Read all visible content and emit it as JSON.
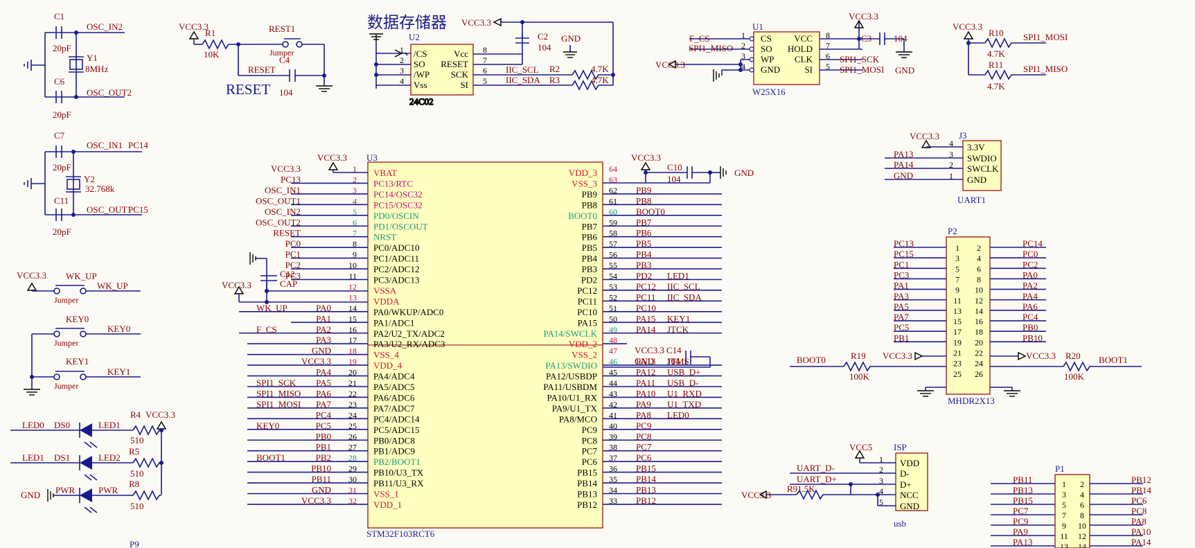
{
  "colors": {
    "wire": "#1a1a8c",
    "net": "#8b0000",
    "body": "#ffffc0",
    "bodyStroke": "#8b0000",
    "pinRed": "#d0103a",
    "pinGreen": "#1a9a7a",
    "pinBlack": "#000000"
  },
  "title_cn": "数据存储器",
  "reset_text": "RESET",
  "osc": {
    "c1": "C1",
    "c6": "C6",
    "c1v": "20pF",
    "c6v": "20pF",
    "y1": "Y1",
    "y1v": "8MHz",
    "osc_in2": "OSC_IN2",
    "osc_out2": "OSC_OUT2",
    "c7": "C7",
    "c11": "C11",
    "c7v": "20pF",
    "c11v": "20pF",
    "y2": "Y2",
    "y2v": "32.768k",
    "osc_in1": "OSC_IN1",
    "pc14": "PC14",
    "osc_out1": "OSC_OUT1",
    "pc15": "PC15"
  },
  "reset_ckt": {
    "vcc": "VCC3.3",
    "r1": "R1",
    "r1v": "10K",
    "rest1": "REST1",
    "jumper": "Jumper",
    "c4": "C4",
    "reset_net": "RESET",
    "c4v": "104"
  },
  "u2": {
    "ref": "U2",
    "part": "24C02",
    "vcc": "VCC3.3",
    "c2": "C2",
    "c2v": "104",
    "gnd": "GND",
    "r2": "R2",
    "r3": "R3",
    "r2v": "4.7K",
    "r3v": "4.7K",
    "iic_scl": "IIC_SCL",
    "iic_sda": "IIC_SDA",
    "left": [
      {
        "n": "1",
        "t": "/CS"
      },
      {
        "n": "2",
        "t": "SO"
      },
      {
        "n": "3",
        "t": "/WP"
      },
      {
        "n": "4",
        "t": "Vss"
      }
    ],
    "right": [
      {
        "n": "8",
        "t": "Vcc"
      },
      {
        "n": "7",
        "t": "RESET"
      },
      {
        "n": "6",
        "t": "SCK"
      },
      {
        "n": "5",
        "t": "SI"
      }
    ]
  },
  "u1": {
    "ref": "U1",
    "part": "W25X16",
    "f_cs": "F_CS",
    "spi1_miso": "SPI1_MISO",
    "vcc": "VCC3.3",
    "c3": "C3",
    "c3v": "104",
    "gnd": "GND",
    "spi1_sck": "SPI1_SCK",
    "spi1_mosi": "SPI1_MOSI",
    "left": [
      {
        "n": "1",
        "t": "CS"
      },
      {
        "n": "2",
        "t": "SO"
      },
      {
        "n": "3",
        "t": "WP"
      },
      {
        "n": "4",
        "t": "GND"
      }
    ],
    "right": [
      {
        "n": "8",
        "t": "VCC"
      },
      {
        "n": "7",
        "t": "HOLD"
      },
      {
        "n": "6",
        "t": "CLK"
      },
      {
        "n": "5",
        "t": "SI"
      }
    ]
  },
  "pullups": {
    "vcc": "VCC3.3",
    "r10": "R10",
    "r10v": "4.7K",
    "n10": "SPI1_MOSI",
    "r11": "R11",
    "r11v": "4.7K",
    "n11": "SPI1_MISO"
  },
  "j3": {
    "ref": "J3",
    "part": "UART1",
    "vcc": "VCC3.3",
    "rows": [
      {
        "n": "4",
        "t": "3.3V",
        "net": ""
      },
      {
        "n": "3",
        "t": "SWDIO",
        "net": "PA13"
      },
      {
        "n": "2",
        "t": "SWCLK",
        "net": "PA14"
      },
      {
        "n": "1",
        "t": "GND",
        "net": "GND"
      }
    ]
  },
  "u3": {
    "ref": "U3",
    "part": "STM32F103RCT6",
    "left": [
      {
        "n": "1",
        "t": "VBAT",
        "c": "r",
        "net": "VCC3.3"
      },
      {
        "n": "2",
        "t": "PC13/RTC",
        "c": "m",
        "net": "PC13"
      },
      {
        "n": "3",
        "t": "PC14/OSC32",
        "c": "m",
        "net": "OSC_IN1"
      },
      {
        "n": "4",
        "t": "PC15/OSC32",
        "c": "m",
        "net": "OSC_OUT1"
      },
      {
        "n": "5",
        "t": "PD0/OSCIN",
        "c": "g",
        "net": "OSC_IN2"
      },
      {
        "n": "6",
        "t": "PD1/OSCOUT",
        "c": "g",
        "net": "OSC_OUT2"
      },
      {
        "n": "7",
        "t": "NRST",
        "c": "g",
        "net": "RESET"
      },
      {
        "n": "8",
        "t": "PC0/ADC10",
        "c": "k",
        "net": "PC0"
      },
      {
        "n": "9",
        "t": "PC1/ADC11",
        "c": "k",
        "net": "PC1"
      },
      {
        "n": "10",
        "t": "PC2/ADC12",
        "c": "k",
        "net": "PC2"
      },
      {
        "n": "11",
        "t": "PC3/ADC13",
        "c": "k",
        "net": "PC3"
      },
      {
        "n": "12",
        "t": "VSSA",
        "c": "r",
        "net": ""
      },
      {
        "n": "13",
        "t": "VDDA",
        "c": "r",
        "net": ""
      },
      {
        "n": "14",
        "t": "PA0/WKUP/ADC0",
        "c": "k",
        "net": "PA0",
        "ext": "WK_UP"
      },
      {
        "n": "15",
        "t": "PA1/ADC1",
        "c": "k",
        "net": "PA1"
      },
      {
        "n": "16",
        "t": "PA2/U2_TX/ADC2",
        "c": "k",
        "net": "PA2",
        "ext": "F_CS"
      },
      {
        "n": "17",
        "t": "PA3/U2_RX/ADC3",
        "c": "k",
        "net": "PA3"
      },
      {
        "n": "18",
        "t": "VSS_4",
        "c": "r",
        "net": "GND"
      },
      {
        "n": "19",
        "t": "VDD_4",
        "c": "r",
        "net": "VCC3.3"
      },
      {
        "n": "20",
        "t": "PA4/ADC4",
        "c": "k",
        "net": "PA4"
      },
      {
        "n": "21",
        "t": "PA5/ADC5",
        "c": "k",
        "net": "PA5",
        "ext": "SPI1_SCK"
      },
      {
        "n": "22",
        "t": "PA6/ADC6",
        "c": "k",
        "net": "PA6",
        "ext": "SPI1_MISO"
      },
      {
        "n": "23",
        "t": "PA7/ADC7",
        "c": "k",
        "net": "PA7",
        "ext": "SPI1_MOSI"
      },
      {
        "n": "24",
        "t": "PC4/ADC14",
        "c": "k",
        "net": "PC4"
      },
      {
        "n": "25",
        "t": "PC5/ADC15",
        "c": "k",
        "net": "PC5",
        "ext": "KEY0"
      },
      {
        "n": "26",
        "t": "PB0/ADC8",
        "c": "k",
        "net": "PB0"
      },
      {
        "n": "27",
        "t": "PB1/ADC9",
        "c": "k",
        "net": "PB1"
      },
      {
        "n": "28",
        "t": "PB2/BOOT1",
        "c": "g",
        "net": "PB2",
        "ext": "BOOT1"
      },
      {
        "n": "29",
        "t": "PB10/U3_TX",
        "c": "k",
        "net": "PB10"
      },
      {
        "n": "30",
        "t": "PB11/U3_RX",
        "c": "k",
        "net": "PB11"
      },
      {
        "n": "31",
        "t": "VSS_1",
        "c": "r",
        "net": "GND"
      },
      {
        "n": "32",
        "t": "VDD_1",
        "c": "r",
        "net": "VCC3.3"
      }
    ],
    "right": [
      {
        "n": "64",
        "t": "VDD_3",
        "c": "r",
        "net": ""
      },
      {
        "n": "63",
        "t": "VSS_3",
        "c": "r",
        "net": ""
      },
      {
        "n": "62",
        "t": "PB9",
        "c": "k",
        "net": "PB9"
      },
      {
        "n": "61",
        "t": "PB8",
        "c": "k",
        "net": "PB8"
      },
      {
        "n": "60",
        "t": "BOOT0",
        "c": "g",
        "net": "BOOT0"
      },
      {
        "n": "59",
        "t": "PB7",
        "c": "k",
        "net": "PB7"
      },
      {
        "n": "58",
        "t": "PB6",
        "c": "k",
        "net": "PB6"
      },
      {
        "n": "57",
        "t": "PB5",
        "c": "k",
        "net": "PB5"
      },
      {
        "n": "56",
        "t": "PB4",
        "c": "k",
        "net": "PB4"
      },
      {
        "n": "55",
        "t": "PB3",
        "c": "k",
        "net": "PB3"
      },
      {
        "n": "54",
        "t": "PD2",
        "c": "k",
        "net": "PD2",
        "ext": "LED1"
      },
      {
        "n": "53",
        "t": "PC12",
        "c": "k",
        "net": "PC12",
        "ext": "IIC_SCL"
      },
      {
        "n": "52",
        "t": "PC11",
        "c": "k",
        "net": "PC11",
        "ext": "IIC_SDA"
      },
      {
        "n": "51",
        "t": "PC10",
        "c": "k",
        "net": "PC10"
      },
      {
        "n": "50",
        "t": "PA15",
        "c": "k",
        "net": "PA15",
        "ext": "KEY1"
      },
      {
        "n": "49",
        "t": "PA14/SWCLK",
        "c": "g",
        "net": "PA14",
        "ext": "JTCK"
      },
      {
        "n": "48",
        "t": "VDD_2",
        "c": "r",
        "net": "VCC3.3"
      },
      {
        "n": "47",
        "t": "VSS_2",
        "c": "r",
        "net": "GND"
      },
      {
        "n": "46",
        "t": "PA13/SWDIO",
        "c": "g",
        "net": "PA13",
        "ext": "JTMS"
      },
      {
        "n": "45",
        "t": "PA12/USBDP",
        "c": "k",
        "net": "PA12",
        "ext": "USB_D+"
      },
      {
        "n": "44",
        "t": "PA11/USBDM",
        "c": "k",
        "net": "PA11",
        "ext": "USB_D-"
      },
      {
        "n": "43",
        "t": "PA10/U1_RX",
        "c": "k",
        "net": "PA10",
        "ext": "U1_RXD"
      },
      {
        "n": "42",
        "t": "PA9/U1_TX",
        "c": "k",
        "net": "PA9",
        "ext": "U1_TXD"
      },
      {
        "n": "41",
        "t": "PA8/MCO",
        "c": "k",
        "net": "PA8",
        "ext": "LED0"
      },
      {
        "n": "40",
        "t": "PC9",
        "c": "k",
        "net": "PC9"
      },
      {
        "n": "39",
        "t": "PC8",
        "c": "k",
        "net": "PC8"
      },
      {
        "n": "38",
        "t": "PC7",
        "c": "k",
        "net": "PC7"
      },
      {
        "n": "37",
        "t": "PC6",
        "c": "k",
        "net": "PC6"
      },
      {
        "n": "36",
        "t": "PB15",
        "c": "k",
        "net": "PB15"
      },
      {
        "n": "35",
        "t": "PB14",
        "c": "k",
        "net": "PB14"
      },
      {
        "n": "34",
        "t": "PB13",
        "c": "k",
        "net": "PB13"
      },
      {
        "n": "33",
        "t": "PB12",
        "c": "k",
        "net": "PB12"
      }
    ],
    "top_left_vcc": "VCC3.3",
    "top_right_vcc": "VCC3.3",
    "c10": "C10",
    "c10v": "104",
    "gnd": "GND",
    "c14": "C14",
    "c14v": "104",
    "vcc48": "VCC3.3",
    "gnd47": "GND",
    "c12": "C12",
    "c12v": "CAP",
    "vcc_a": "VCC3.3"
  },
  "keys": {
    "vcc": "VCC3.3",
    "wk": "WK_UP",
    "jumper": "Jumper",
    "wk_net": "WK_UP",
    "key0": "KEY0",
    "key0_net": "KEY0",
    "key1": "KEY1",
    "key1_net": "KEY1"
  },
  "leds": {
    "r4": "R4",
    "vcc": "VCC3.3",
    "r4v": "510",
    "r5": "R5",
    "r5v": "510",
    "r8": "R8",
    "r8v": "510",
    "led0": "LED0",
    "ds0": "DS0",
    "led1_lbl": "LED1",
    "led1": "LED1",
    "ds1": "DS1",
    "led2_lbl": "LED2",
    "gnd": "GND",
    "pwr": "PWR",
    "pwr2": "PWR"
  },
  "p2": {
    "ref": "P2",
    "part": "MHDR2X13",
    "leftNets": [
      "PC13",
      "PC15",
      "PC1",
      "PC3",
      "PA1",
      "PA3",
      "PA5",
      "PA7",
      "PC5",
      "PB1",
      "",
      "",
      ""
    ],
    "rightNets": [
      "PC14",
      "PC0",
      "PC2",
      "PA0",
      "PA2",
      "PA4",
      "PA6",
      "PC4",
      "PB0",
      "PB10",
      "",
      "",
      ""
    ],
    "boot0": "BOOT0",
    "r19": "R19",
    "r19v": "100K",
    "vcc_l": "VCC3.3",
    "vcc_r": "VCC3.3",
    "r20": "R20",
    "r20v": "100K",
    "boot1": "BOOT1"
  },
  "isp": {
    "ref": "ISP",
    "part": "usb",
    "vcc5": "VCC5",
    "d_minus": "UART_D-",
    "d_plus": "UART_D+",
    "vcc": "VCC3.3",
    "r9": "R9",
    "r9v": "1.5K",
    "pins": [
      {
        "n": "1",
        "t": "VDD"
      },
      {
        "n": "2",
        "t": "D-"
      },
      {
        "n": "3",
        "t": "D+"
      },
      {
        "n": "4",
        "t": "NCC"
      },
      {
        "n": "5",
        "t": "GND"
      }
    ]
  },
  "p1": {
    "ref": "P1",
    "leftNets": [
      "PB11",
      "PB13",
      "PB15",
      "PC7",
      "PC9",
      "PA9",
      "PA13"
    ],
    "rightNets": [
      "PB12",
      "PB14",
      "PC6",
      "PC8",
      "PA8",
      "PA10",
      "PA14"
    ]
  },
  "p9": "P9"
}
